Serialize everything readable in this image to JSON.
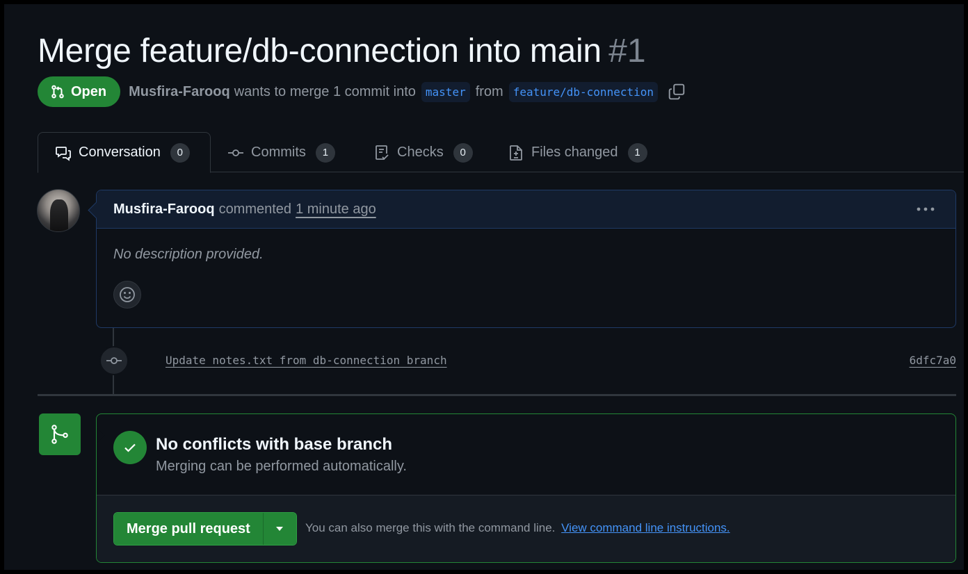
{
  "header": {
    "title": "Merge feature/db-connection into main",
    "number": "#1",
    "state": "Open",
    "author": "Musfira-Farooq",
    "merge_text": "wants to merge 1 commit into",
    "base_branch": "master",
    "from_text": "from",
    "head_branch": "feature/db-connection"
  },
  "tabs": [
    {
      "label": "Conversation",
      "count": "0",
      "icon": "comment-discussion-icon",
      "active": true
    },
    {
      "label": "Commits",
      "count": "1",
      "icon": "git-commit-icon"
    },
    {
      "label": "Checks",
      "count": "0",
      "icon": "checklist-icon"
    },
    {
      "label": "Files changed",
      "count": "1",
      "icon": "file-diff-icon"
    }
  ],
  "comment": {
    "author": "Musfira-Farooq",
    "action": "commented",
    "time": "1 minute ago",
    "body": "No description provided."
  },
  "commit": {
    "message": "Update notes.txt from db-connection branch",
    "sha": "6dfc7a0"
  },
  "merge": {
    "status_title": "No conflicts with base branch",
    "status_subtitle": "Merging can be performed automatically.",
    "button_label": "Merge pull request",
    "cmd_text": "You can also merge this with the command line.",
    "cmd_link": "View command line instructions."
  },
  "colors": {
    "background": "#0d1117",
    "accent_green": "#238636",
    "link_blue": "#4493f8",
    "muted": "#9198a1"
  }
}
